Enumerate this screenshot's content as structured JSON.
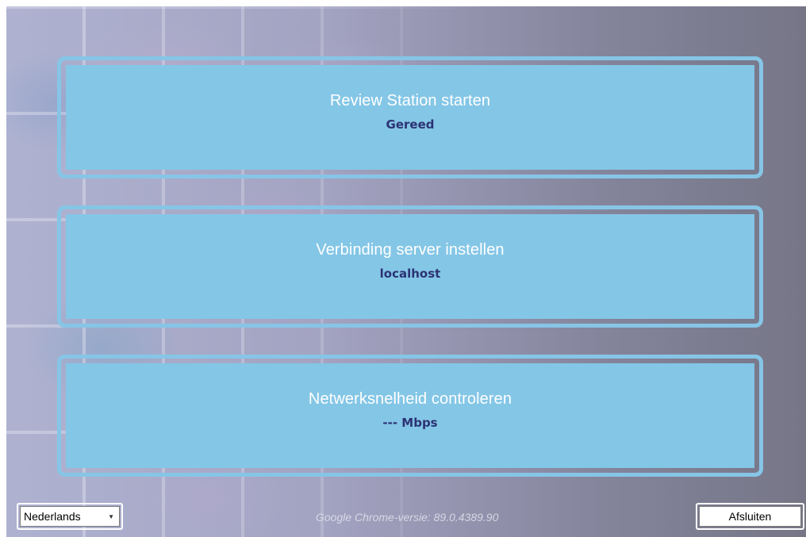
{
  "tiles": [
    {
      "title": "Review Station starten",
      "status": "Gereed"
    },
    {
      "title": "Verbinding server instellen",
      "status": "localhost"
    },
    {
      "title": "Netwerksnelheid controleren",
      "status": "--- Mbps"
    }
  ],
  "footer": {
    "language": {
      "selected": "Nederlands",
      "icon": "chevron-down-icon"
    },
    "version_text": "Google Chrome-versie:  89.0.4389.90",
    "quit_label": "Afsluiten"
  },
  "colors": {
    "tile_fill": "#84c6e6",
    "tile_border": "#86c5e6",
    "status_text": "#2c3374",
    "title_text": "#ffffff"
  }
}
